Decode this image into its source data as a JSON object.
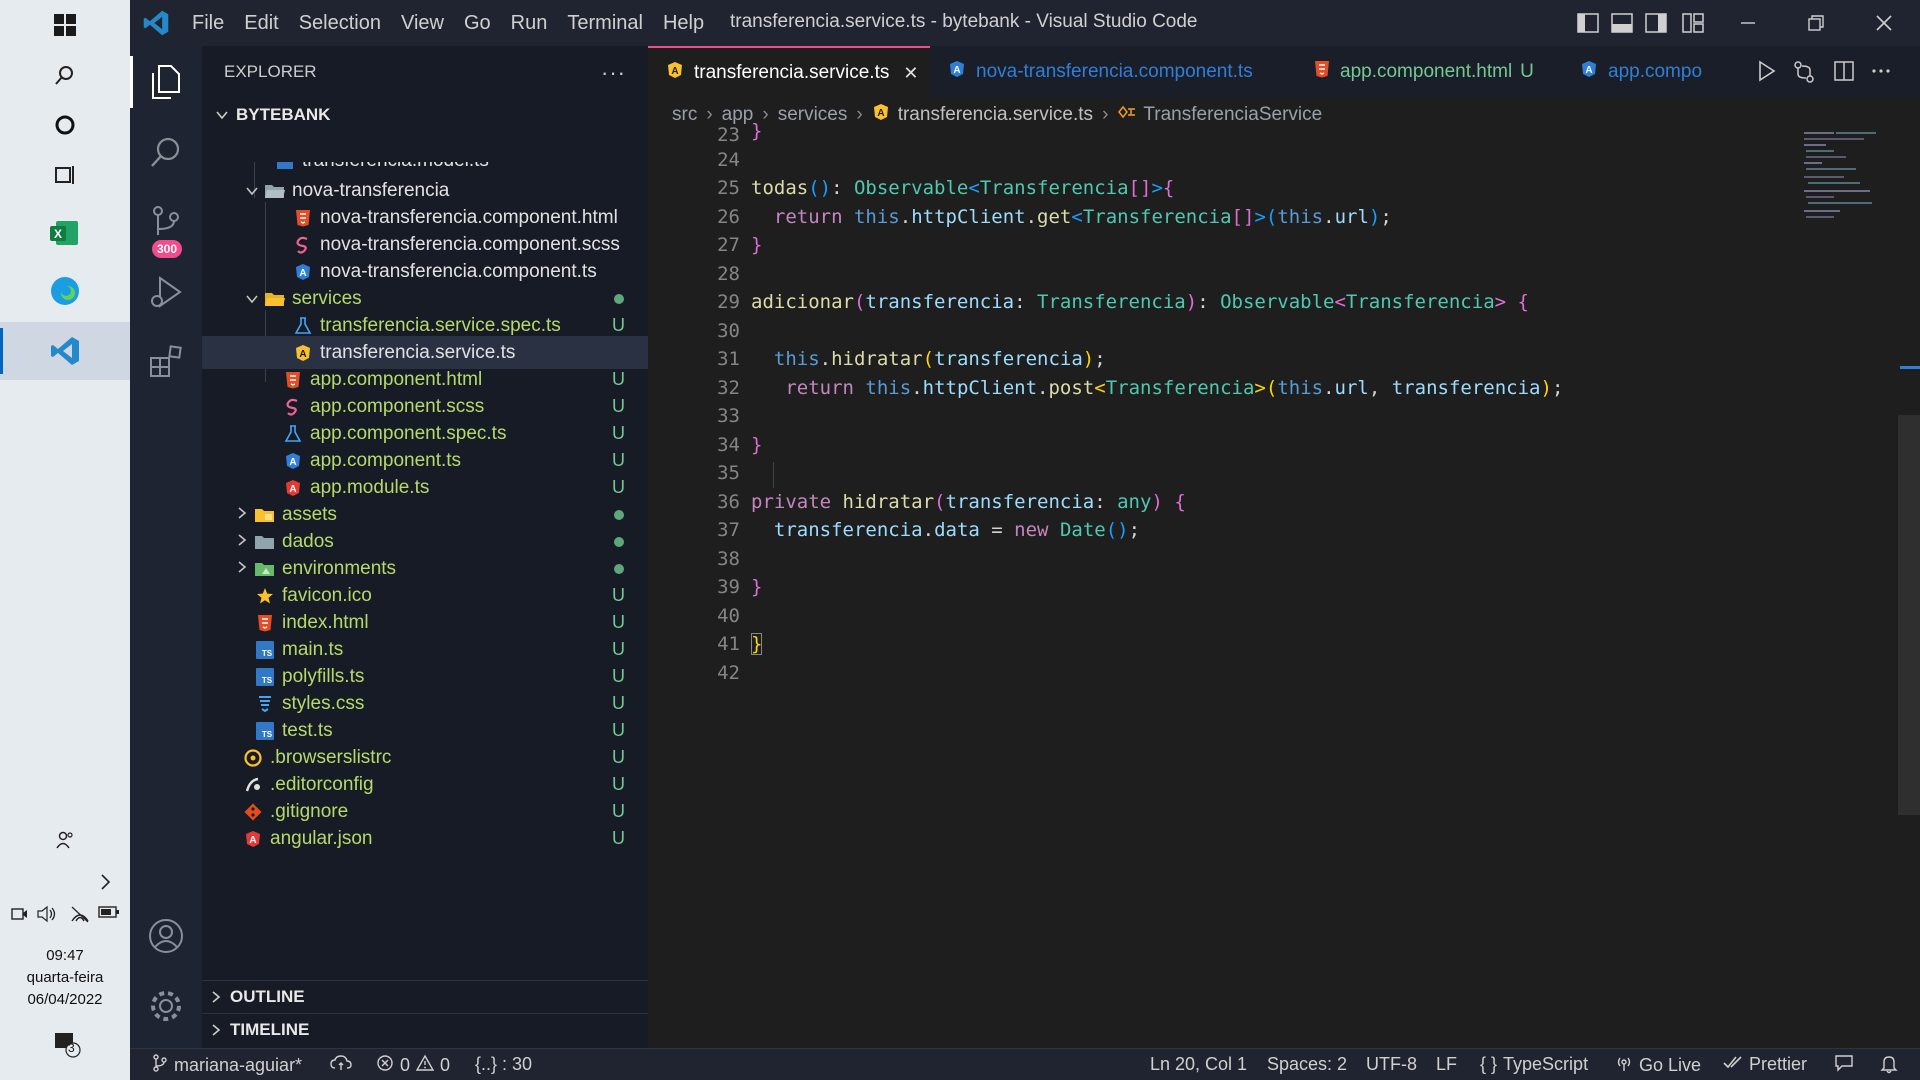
{
  "taskbar": {
    "clock_time": "09:47",
    "clock_day": "quarta-feira",
    "clock_date": "06/04/2022",
    "notification_count": "3"
  },
  "titlebar": {
    "menu": [
      "File",
      "Edit",
      "Selection",
      "View",
      "Go",
      "Run",
      "Terminal",
      "Help"
    ],
    "window_title": "transferencia.service.ts - bytebank - Visual Studio Code"
  },
  "activitybar": {
    "scm_badge": "300"
  },
  "sidebar": {
    "header": "EXPLORER",
    "more": "···",
    "workspace": "BYTEBANK",
    "items": [
      {
        "label": "transferencia.model.ts",
        "status": ""
      },
      {
        "label": "nova-transferencia",
        "status": ""
      },
      {
        "label": "nova-transferencia.component.html",
        "status": ""
      },
      {
        "label": "nova-transferencia.component.scss",
        "status": ""
      },
      {
        "label": "nova-transferencia.component.ts",
        "status": ""
      },
      {
        "label": "services",
        "status": "dot"
      },
      {
        "label": "transferencia.service.spec.ts",
        "status": "U"
      },
      {
        "label": "transferencia.service.ts",
        "status": ""
      },
      {
        "label": "app.component.html",
        "status": "U"
      },
      {
        "label": "app.component.scss",
        "status": "U"
      },
      {
        "label": "app.component.spec.ts",
        "status": "U"
      },
      {
        "label": "app.component.ts",
        "status": "U"
      },
      {
        "label": "app.module.ts",
        "status": "U"
      },
      {
        "label": "assets",
        "status": "dot"
      },
      {
        "label": "dados",
        "status": "dot"
      },
      {
        "label": "environments",
        "status": "dot"
      },
      {
        "label": "favicon.ico",
        "status": "U"
      },
      {
        "label": "index.html",
        "status": "U"
      },
      {
        "label": "main.ts",
        "status": "U"
      },
      {
        "label": "polyfills.ts",
        "status": "U"
      },
      {
        "label": "styles.css",
        "status": "U"
      },
      {
        "label": "test.ts",
        "status": "U"
      },
      {
        "label": ".browserslistrc",
        "status": "U"
      },
      {
        "label": ".editorconfig",
        "status": "U"
      },
      {
        "label": ".gitignore",
        "status": "U"
      },
      {
        "label": "angular.json",
        "status": "U"
      }
    ],
    "outline": "OUTLINE",
    "timeline": "TIMELINE"
  },
  "tabs": [
    {
      "label": "transferencia.service.ts",
      "close": "✕",
      "badge": ""
    },
    {
      "label": "nova-transferencia.component.ts",
      "close": "",
      "badge": ""
    },
    {
      "label": "app.component.html",
      "close": "",
      "badge": "U"
    },
    {
      "label": "app.compo",
      "close": "",
      "badge": ""
    }
  ],
  "breadcrumb": {
    "parts": [
      "src",
      "app",
      "services",
      "transferencia.service.ts",
      "TransferenciaService"
    ]
  },
  "editor": {
    "line_numbers": [
      "23",
      "24",
      "25",
      "26",
      "27",
      "28",
      "29",
      "30",
      "31",
      "32",
      "33",
      "34",
      "35",
      "36",
      "37",
      "38",
      "39",
      "40",
      "41",
      "42"
    ]
  },
  "statusbar": {
    "branch": "mariana-aguiar*",
    "errors": "0",
    "warnings": "0",
    "braces": "{..} : 30",
    "position": "Ln 20, Col 1",
    "spaces": "Spaces: 2",
    "encoding": "UTF-8",
    "eol": "LF",
    "language": "TypeScript",
    "golive": "Go Live",
    "prettier": "Prettier"
  }
}
